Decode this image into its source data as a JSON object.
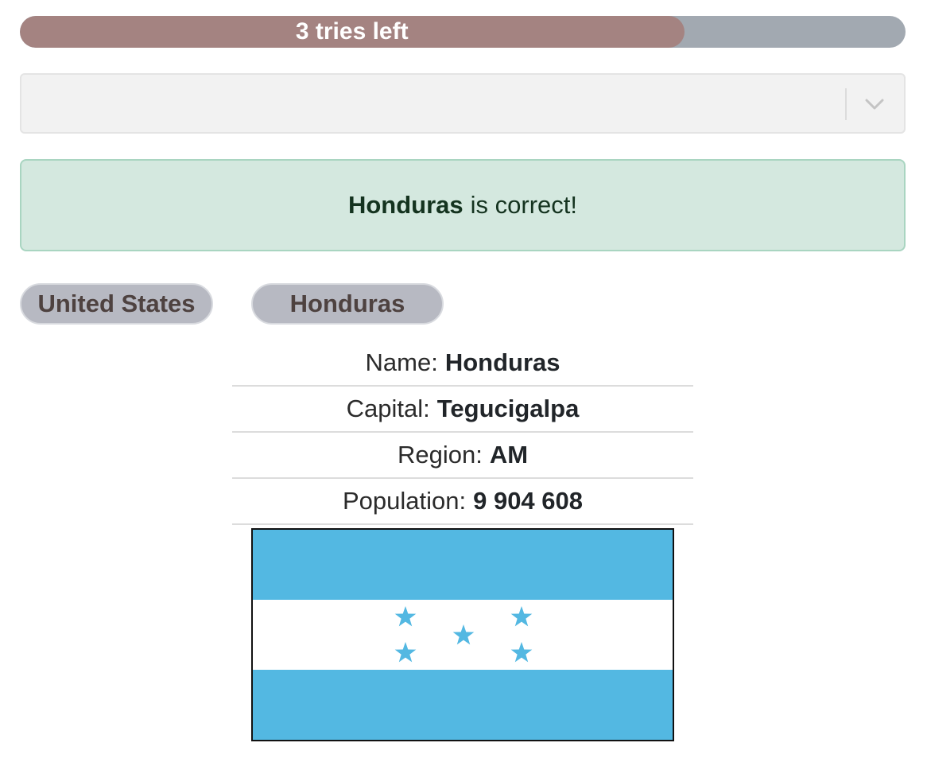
{
  "progress": {
    "label": "3 tries left",
    "fraction": 0.75,
    "fill_color": "#a48381",
    "track_color": "#a2a9b1"
  },
  "select": {
    "value": "",
    "indicator_icon": "chevron-down-icon"
  },
  "alert": {
    "country": "Honduras",
    "message": "is correct!"
  },
  "guesses": [
    {
      "label": "United States"
    },
    {
      "label": "Honduras"
    }
  ],
  "info": [
    {
      "label": "Name:",
      "value": "Honduras"
    },
    {
      "label": "Capital:",
      "value": "Tegucigalpa"
    },
    {
      "label": "Region:",
      "value": "AM"
    },
    {
      "label": "Population:",
      "value": "9 904 608"
    }
  ],
  "flag": {
    "country": "Honduras",
    "stripe_color": "#53b8e2",
    "center_color": "#ffffff",
    "star_color": "#53b8e2"
  }
}
